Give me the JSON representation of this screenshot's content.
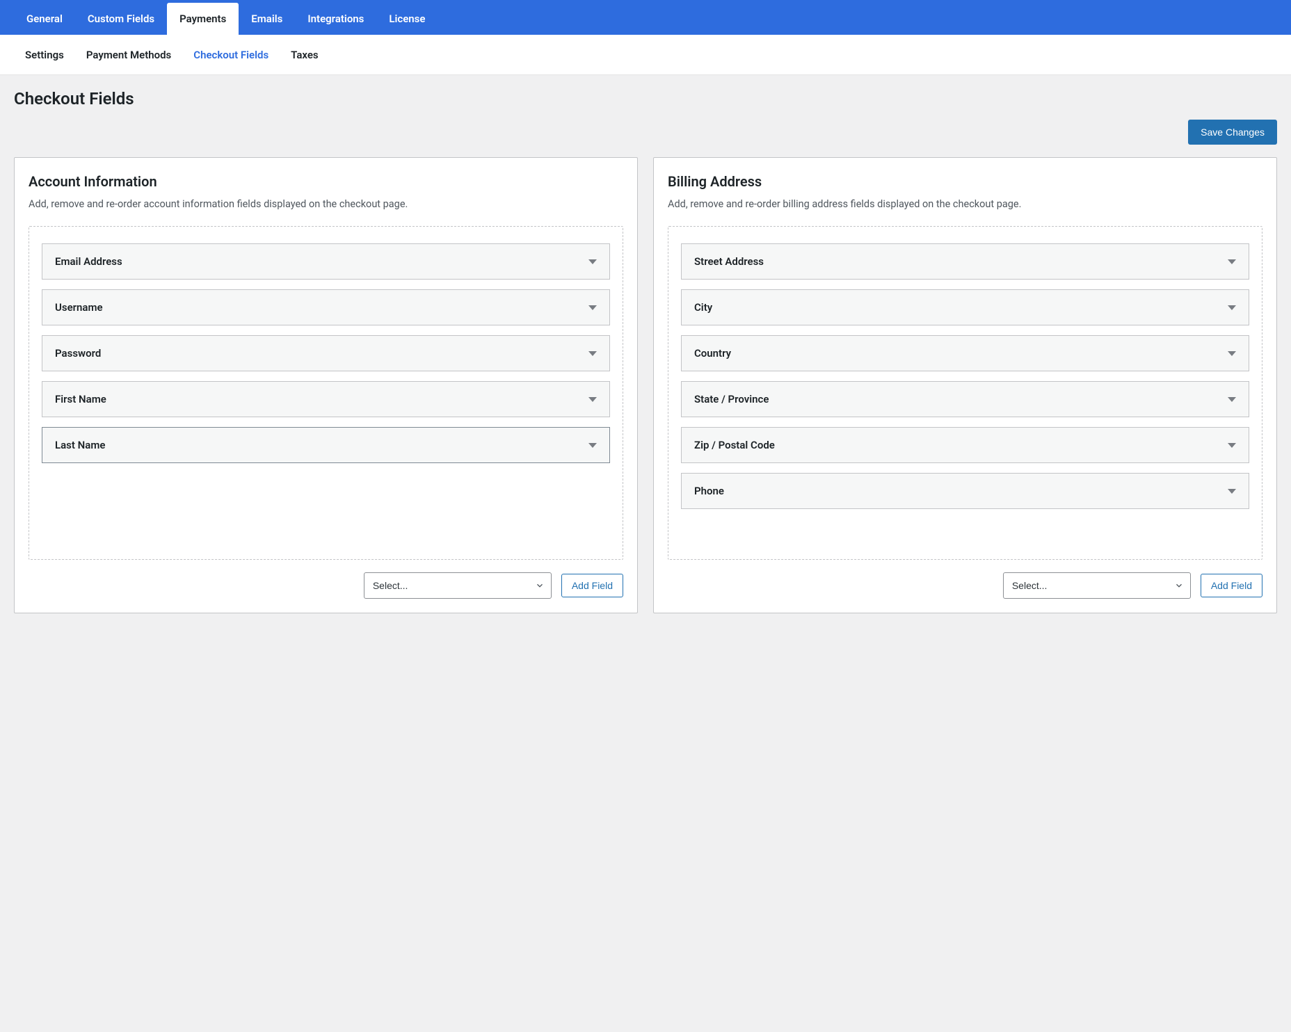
{
  "primaryTabs": {
    "items": [
      {
        "label": "General"
      },
      {
        "label": "Custom Fields"
      },
      {
        "label": "Payments"
      },
      {
        "label": "Emails"
      },
      {
        "label": "Integrations"
      },
      {
        "label": "License"
      }
    ]
  },
  "subTabs": {
    "items": [
      {
        "label": "Settings"
      },
      {
        "label": "Payment Methods"
      },
      {
        "label": "Checkout Fields"
      },
      {
        "label": "Taxes"
      }
    ]
  },
  "pageTitle": "Checkout Fields",
  "saveLabel": "Save Changes",
  "account": {
    "title": "Account Information",
    "description": "Add, remove and re-order account information fields displayed on the checkout page.",
    "fields": [
      {
        "label": "Email Address"
      },
      {
        "label": "Username"
      },
      {
        "label": "Password"
      },
      {
        "label": "First Name"
      },
      {
        "label": "Last Name"
      }
    ],
    "selectPlaceholder": "Select...",
    "addLabel": "Add Field"
  },
  "billing": {
    "title": "Billing Address",
    "description": "Add, remove and re-order billing address fields displayed on the checkout page.",
    "fields": [
      {
        "label": "Street Address"
      },
      {
        "label": "City"
      },
      {
        "label": "Country"
      },
      {
        "label": "State / Province"
      },
      {
        "label": "Zip / Postal Code"
      },
      {
        "label": "Phone"
      }
    ],
    "selectPlaceholder": "Select...",
    "addLabel": "Add Field"
  }
}
